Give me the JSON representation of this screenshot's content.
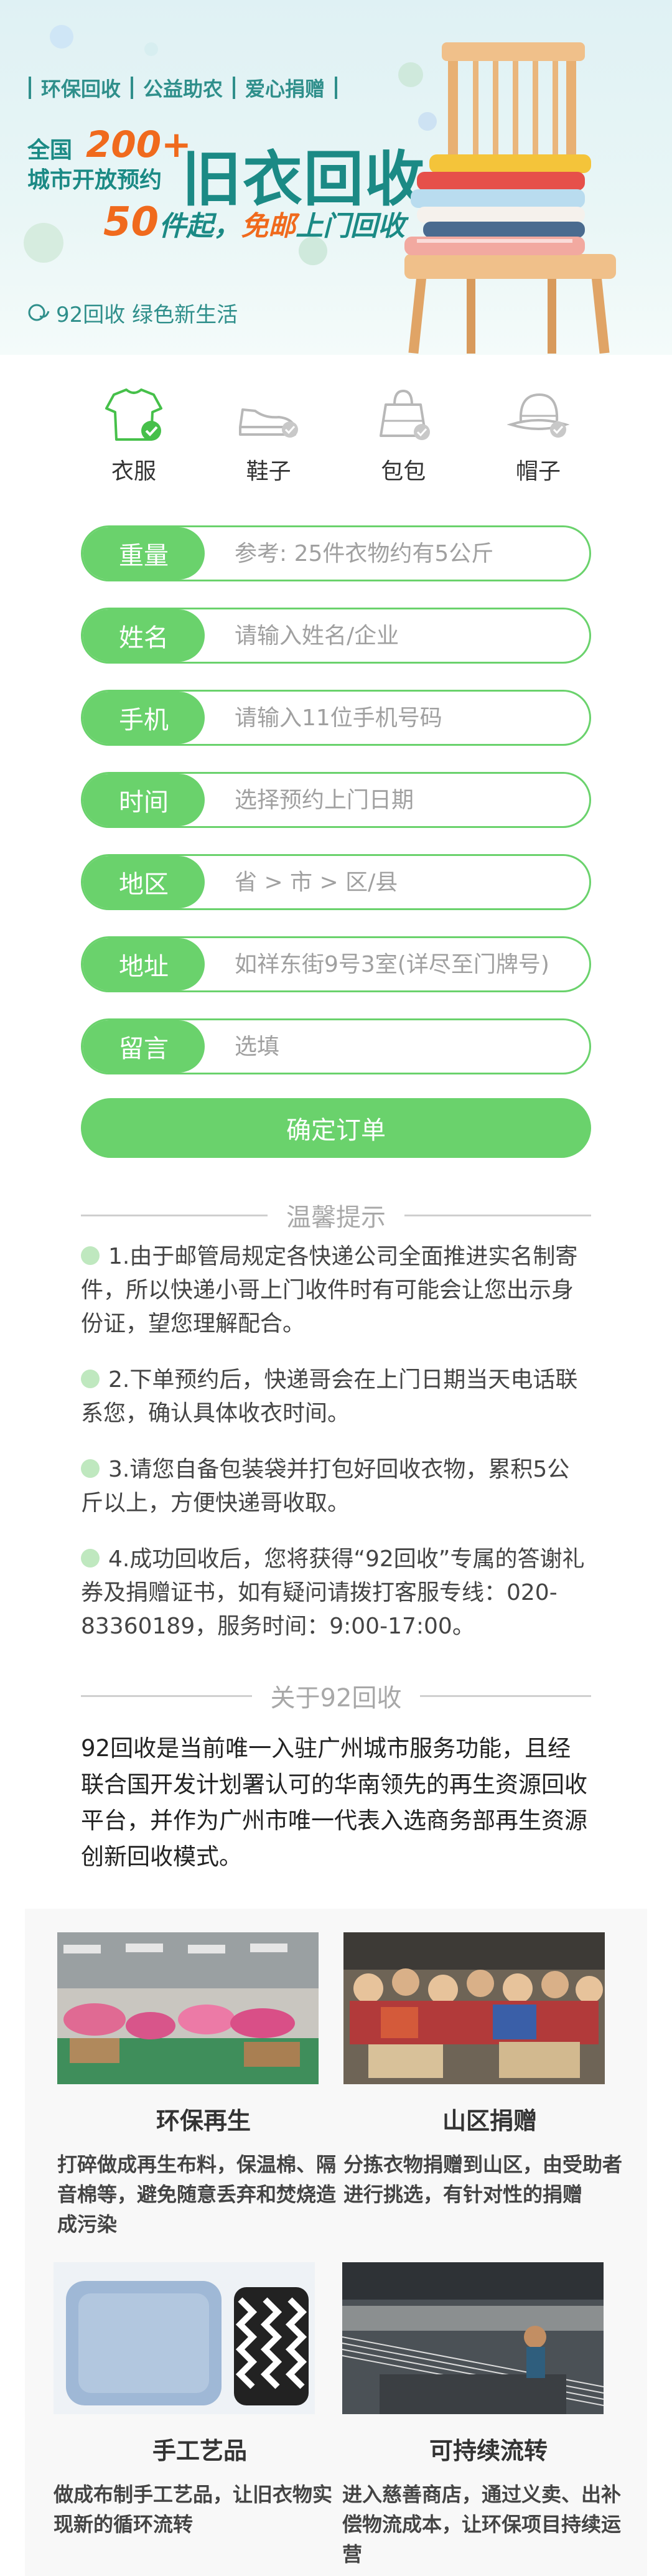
{
  "hero": {
    "tags": [
      "环保回收",
      "公益助农",
      "爱心捐赠"
    ],
    "headline_left": [
      "全国",
      "城市开放预约"
    ],
    "headline_count": "200+",
    "headline_big": "旧衣回收",
    "sub_count": "50",
    "sub_text1": "件起，",
    "sub_text2": "免邮",
    "sub_text3": "上门回收",
    "brand": "92回收 绿色新生活"
  },
  "categories": [
    {
      "label": "衣服",
      "icon": "shirt-icon",
      "selected": true
    },
    {
      "label": "鞋子",
      "icon": "shoe-icon",
      "selected": false
    },
    {
      "label": "包包",
      "icon": "bag-icon",
      "selected": false
    },
    {
      "label": "帽子",
      "icon": "hat-icon",
      "selected": false
    }
  ],
  "form": {
    "weight": {
      "label": "重量",
      "placeholder": "参考: 25件衣物约有5公斤"
    },
    "name": {
      "label": "姓名",
      "placeholder": "请输入姓名/企业"
    },
    "phone": {
      "label": "手机",
      "placeholder": "请输入11位手机号码"
    },
    "time": {
      "label": "时间",
      "placeholder": "选择预约上门日期"
    },
    "region": {
      "label": "地区",
      "placeholder": "省 > 市 > 区/县"
    },
    "address": {
      "label": "地址",
      "placeholder": "如祥东街9号3室(详尽至门牌号)"
    },
    "message": {
      "label": "留言",
      "placeholder": "选填"
    },
    "submit_label": "确定订单"
  },
  "tips_title": "温馨提示",
  "tips": [
    "1.由于邮管局规定各快递公司全面推进实名制寄件，所以快递小哥上门收件时有可能会让您出示身份证，望您理解配合。",
    "2.下单预约后，快递哥会在上门日期当天电话联系您，确认具体收衣时间。",
    "3.请您自备包装袋并打包好回收衣物，累积5公斤以上，方便快递哥收取。",
    "4.成功回收后，您将获得“92回收”专属的答谢礼券及捐赠证书，如有疑问请拨打客服专线：020-83360189，服务时间：9:00-17:00。"
  ],
  "about_title": "关于92回收",
  "about_text": "92回收是当前唯一入驻广州城市服务功能，且经联合国开发计划署认可的华南领先的再生资源回收平台，并作为广州市唯一代表入选商务部再生资源创新回收模式。",
  "cards": [
    {
      "title": "环保再生",
      "desc": "打碎做成再生布料，保温棉、隔音棉等，避免随意丢弃和焚烧造成污染"
    },
    {
      "title": "山区捐赠",
      "desc": "分拣衣物捐赠到山区，由受助者进行挑选，有针对性的捐赠"
    },
    {
      "title": "手工艺品",
      "desc": "做成布制手工艺品，让旧衣物实现新的循环流转"
    },
    {
      "title": "可持续流转",
      "desc": "进入慈善商店，通过义卖、出补偿物流成本，让环保项目持续运营"
    }
  ],
  "colors": {
    "accent": "#6ad26c",
    "teal": "#1b8a85",
    "orange": "#f06a1d"
  }
}
